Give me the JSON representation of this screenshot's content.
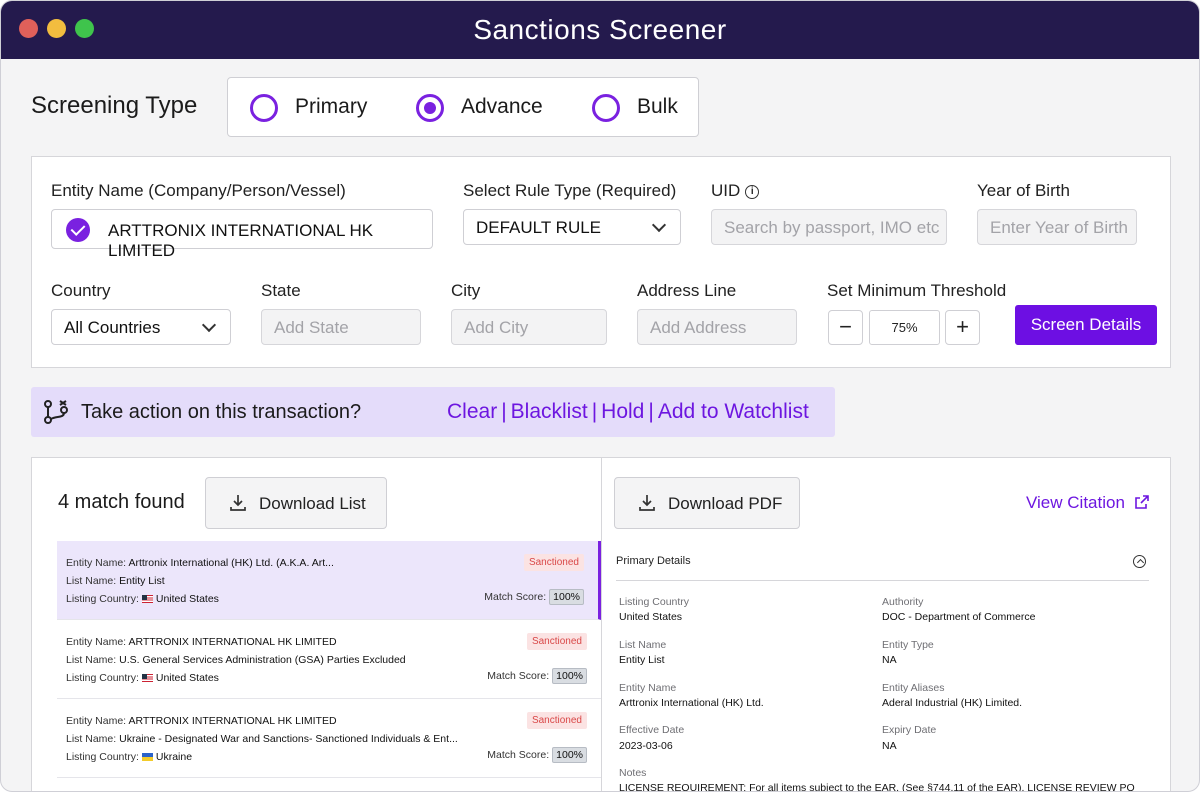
{
  "window": {
    "title": "Sanctions Screener"
  },
  "screening": {
    "label": "Screening Type",
    "options": [
      {
        "label": "Primary",
        "selected": false
      },
      {
        "label": "Advance",
        "selected": true
      },
      {
        "label": "Bulk",
        "selected": false
      }
    ]
  },
  "form": {
    "entity_name": {
      "label": "Entity Name (Company/Person/Vessel)",
      "value": "ARTTRONIX INTERNATIONAL HK LIMITED"
    },
    "rule_type": {
      "label": "Select Rule Type (Required)",
      "value": "DEFAULT RULE"
    },
    "uid": {
      "label": "UID",
      "placeholder": "Search by passport, IMO etc"
    },
    "year_of_birth": {
      "label": "Year of Birth",
      "placeholder": "Enter Year of Birth"
    },
    "country": {
      "label": "Country",
      "value": "All Countries"
    },
    "state": {
      "label": "State",
      "placeholder": "Add State"
    },
    "city": {
      "label": "City",
      "placeholder": "Add City"
    },
    "address": {
      "label": "Address Line",
      "placeholder": "Add Address"
    },
    "threshold": {
      "label": "Set Minimum Threshold",
      "value": "75%",
      "minus": "−",
      "plus": "+"
    },
    "screen_button": "Screen Details"
  },
  "action_bar": {
    "prompt": "Take action on this transaction?",
    "links": [
      "Clear",
      "Blacklist",
      "Hold",
      "Add to Watchlist"
    ],
    "separator": "|"
  },
  "results": {
    "count_label": "4 match found",
    "download_list": "Download List",
    "keys": {
      "entity": "Entity Name:",
      "list": "List Name:",
      "country": "Listing Country:",
      "score": "Match Score:"
    },
    "items": [
      {
        "entity": "Arttronix International (HK) Ltd. (A.K.A. Art...",
        "list": "Entity List",
        "country": "United States",
        "flag": "us",
        "status": "Sanctioned",
        "score": "100%"
      },
      {
        "entity": "ARTTRONIX INTERNATIONAL HK LIMITED",
        "list": "U.S. General Services Administration (GSA) Parties Excluded",
        "country": "United States",
        "flag": "us",
        "status": "Sanctioned",
        "score": "100%"
      },
      {
        "entity": "ARTTRONIX INTERNATIONAL HK LIMITED",
        "list": "Ukraine - Designated War and Sanctions- Sanctioned Individuals & Ent...",
        "country": "Ukraine",
        "flag": "ua",
        "status": "Sanctioned",
        "score": "100%"
      }
    ]
  },
  "detail": {
    "download_pdf": "Download PDF",
    "view_citation": "View Citation",
    "section_title": "Primary Details",
    "fields": {
      "listing_country": {
        "k": "Listing Country",
        "v": "United States"
      },
      "authority": {
        "k": "Authority",
        "v": "DOC - Department of Commerce"
      },
      "list_name": {
        "k": "List Name",
        "v": "Entity List"
      },
      "entity_type": {
        "k": "Entity Type",
        "v": "NA"
      },
      "entity_name": {
        "k": "Entity Name",
        "v": "Arttronix International (HK) Ltd."
      },
      "entity_aliases": {
        "k": "Entity Aliases",
        "v": "Aderal Industrial (HK) Limited."
      },
      "effective_date": {
        "k": "Effective Date",
        "v": "2023-03-06"
      },
      "expiry_date": {
        "k": "Expiry Date",
        "v": "NA"
      },
      "notes": {
        "k": "Notes",
        "v": "LICENSE REQUIREMENT: For all items subject to the EAR. (See §744.11 of the EAR). LICENSE REVIEW PO"
      }
    }
  },
  "colors": {
    "accent": "#6d0fe3",
    "titlebar": "#241a4d",
    "badge_bg": "#fbe3e3",
    "badge_text": "#d94848",
    "action_bg": "#e4dcfa"
  }
}
